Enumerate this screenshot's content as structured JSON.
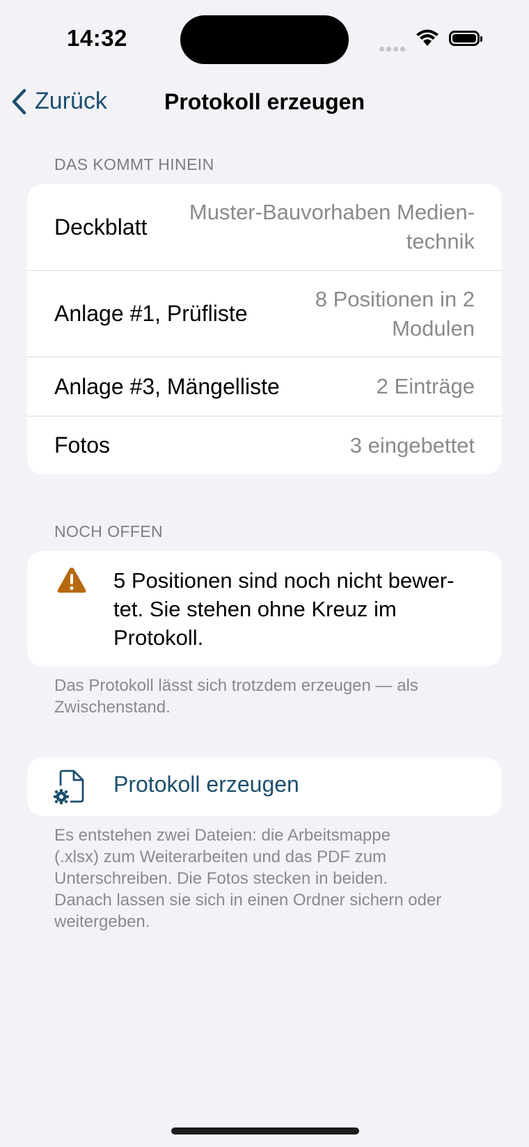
{
  "status_bar": {
    "time": "14:32"
  },
  "nav": {
    "back_label": "Zurück",
    "title": "Protokoll erzeugen"
  },
  "section_contents": {
    "header": "DAS KOMMT HINEIN",
    "rows": [
      {
        "label": "Deckblatt",
        "value": "Muster-Bauvorhaben Medien-\ntechnik"
      },
      {
        "label": "Anlage #1, Prüfliste",
        "value": "8 Positionen in 2\nModulen"
      },
      {
        "label": "Anlage #3, Mängelliste",
        "value": "2 Einträge"
      },
      {
        "label": "Fotos",
        "value": "3 eingebettet"
      }
    ]
  },
  "section_open": {
    "header": "NOCH OFFEN",
    "warning_text": "5 Positionen sind noch nicht bewer-\ntet. Sie stehen ohne Kreuz im\nProtokoll.",
    "footnote": "Das Protokoll lässt sich trotzdem erzeugen — als\nZwischenstand."
  },
  "action": {
    "label": "Protokoll erzeugen",
    "footnote": "Es entstehen zwei Dateien: die Arbeitsmappe\n(.xlsx) zum Weiterarbeiten und das PDF zum\nUnterschreiben. Die Fotos stecken in beiden.\nDanach lassen sie sich in einen Ordner sichern oder\nweitergeben."
  },
  "colors": {
    "accent": "#1d4f6e",
    "warning": "#b7690f",
    "background": "#f2f2f7",
    "secondary_text": "#8a8a8e"
  },
  "icons": {
    "back": "chevron-left-icon",
    "warning": "warning-triangle-icon",
    "action": "document-gear-icon"
  }
}
